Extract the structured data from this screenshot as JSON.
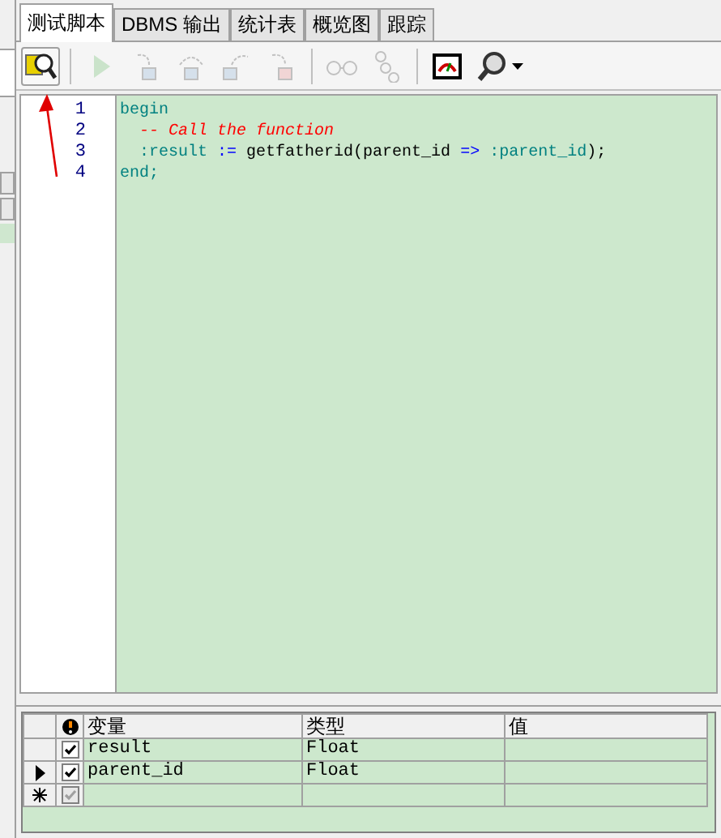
{
  "tabs": [
    {
      "label": "测试脚本",
      "selected": true
    },
    {
      "label": "DBMS 输出",
      "selected": false
    },
    {
      "label": "统计表",
      "selected": false
    },
    {
      "label": "概览图",
      "selected": false
    },
    {
      "label": "跟踪",
      "selected": false
    }
  ],
  "toolbar": [
    {
      "kind": "debug",
      "disabled": false
    },
    {
      "kind": "sep"
    },
    {
      "kind": "run",
      "disabled": true
    },
    {
      "kind": "step-into",
      "disabled": true
    },
    {
      "kind": "step-over",
      "disabled": true
    },
    {
      "kind": "step-out",
      "disabled": true
    },
    {
      "kind": "run-to-exception",
      "disabled": true
    },
    {
      "kind": "sep"
    },
    {
      "kind": "watch",
      "disabled": true
    },
    {
      "kind": "breakpoints",
      "disabled": true
    },
    {
      "kind": "sep"
    },
    {
      "kind": "monitor",
      "disabled": false
    },
    {
      "kind": "search",
      "disabled": false
    }
  ],
  "editor": {
    "lines": [
      {
        "number": "1",
        "tokens": [
          {
            "kind": "keyword",
            "text": "begin"
          }
        ]
      },
      {
        "number": "2",
        "tokens": [
          {
            "kind": "comment",
            "text": "  -- Call the function"
          }
        ]
      },
      {
        "number": "3",
        "tokens": [
          {
            "kind": "bind",
            "text": "  :result"
          },
          {
            "kind": "op",
            "text": " :="
          },
          {
            "kind": "plain",
            "text": " getfatherid(parent_id"
          },
          {
            "kind": "op",
            "text": " =>"
          },
          {
            "kind": "bind",
            "text": " :parent_id"
          },
          {
            "kind": "plain",
            "text": ");"
          }
        ]
      },
      {
        "number": "4",
        "tokens": [
          {
            "kind": "keyword",
            "text": "end;"
          }
        ]
      }
    ]
  },
  "variables": {
    "columns": [
      "变量",
      "类型",
      "值"
    ],
    "rows": [
      {
        "current": false,
        "new_row": false,
        "checked": true,
        "disabled": false,
        "name": "result",
        "type": "Float"
      },
      {
        "current": true,
        "new_row": false,
        "checked": true,
        "disabled": false,
        "name": "parent_id",
        "type": "Float"
      },
      {
        "current": false,
        "new_row": true,
        "checked": true,
        "disabled": true
      }
    ]
  }
}
